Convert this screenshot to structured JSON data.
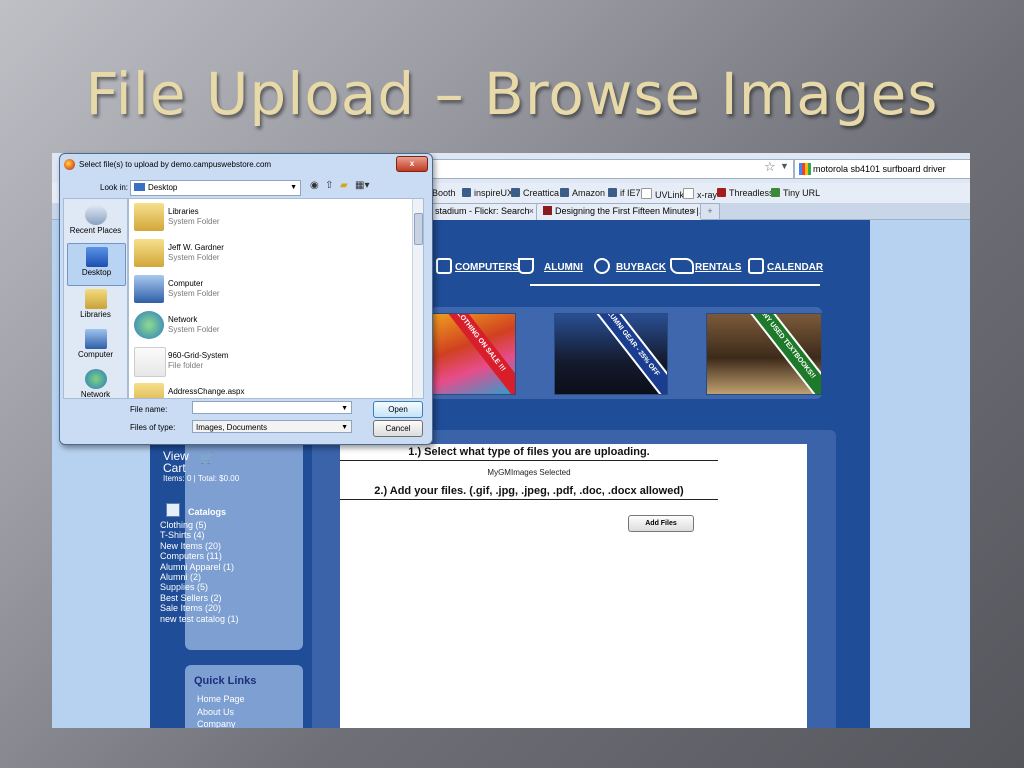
{
  "slide": {
    "title": "File Upload – Browse Images"
  },
  "browser": {
    "search_text": "motorola sb4101 surfboard driver",
    "bookmarks": [
      "Booth",
      "inspireUX",
      "Creattica",
      "Amazon",
      "if IE7",
      "UVLink",
      "x-ray",
      "Threadless",
      "Tiny URL"
    ],
    "tabs": [
      {
        "label": "stadium - Flickr: Search"
      },
      {
        "label": "Designing the First Fifteen Minutes |..."
      }
    ]
  },
  "site": {
    "nav": [
      "COMPUTERS",
      "ALUMNI",
      "BUYBACK",
      "RENTALS",
      "CALENDAR"
    ],
    "promos": [
      "CLOTHING ON SALE !!!",
      "ALUMNI GEAR - 25% OFF",
      "MANY USED TEXTBOOKS!!"
    ],
    "cart": {
      "view_label": "View",
      "cart_label": "Cart",
      "items_text": "Items: 0 | Total: $0.00"
    },
    "catalogs": {
      "heading": "Catalogs",
      "items": [
        "Clothing (5)",
        "T-Shirts (4)",
        "New Items (20)",
        "Computers (11)",
        "Alumni Apparel (1)",
        "Alumni (2)",
        "Supplies (5)",
        "Best Sellers (2)",
        "Sale Items (20)",
        "new test catalog (1)"
      ]
    },
    "quick_links": {
      "title": "Quick Links",
      "items": [
        "Home Page",
        "About Us",
        "Company"
      ]
    },
    "upload": {
      "step1": "1.) Select what type of files you are uploading.",
      "selected": "MyGMImages Selected",
      "step2": "2.) Add your files. (.gif, .jpg, .jpeg, .pdf, .doc, .docx allowed)",
      "add_button": "Add Files"
    }
  },
  "dialog": {
    "title": "Select file(s) to upload by demo.campuswebstore.com",
    "look_in_label": "Look in:",
    "look_in_value": "Desktop",
    "places": [
      "Recent Places",
      "Desktop",
      "Libraries",
      "Computer",
      "Network"
    ],
    "files": [
      {
        "name": "Libraries",
        "type": "System Folder"
      },
      {
        "name": "Jeff W. Gardner",
        "type": "System Folder"
      },
      {
        "name": "Computer",
        "type": "System Folder"
      },
      {
        "name": "Network",
        "type": "System Folder"
      },
      {
        "name": "960-Grid-System",
        "type": "File folder"
      },
      {
        "name": "AddressChange.aspx",
        "type": ""
      }
    ],
    "file_name_label": "File name:",
    "file_name_value": "",
    "files_of_type_label": "Files of type:",
    "files_of_type_value": "Images, Documents",
    "open_button": "Open",
    "cancel_button": "Cancel",
    "close_glyph": "x"
  },
  "colors": {
    "site_blue": "#1f4d97",
    "page_bg": "#b7d1f0",
    "sidebar": "#7d9fd2",
    "title_gold": "#e7d9a8"
  }
}
